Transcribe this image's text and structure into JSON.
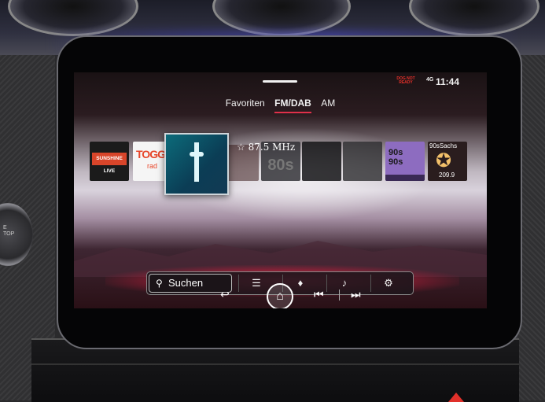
{
  "status": {
    "warning": "DOG NOT READY",
    "signal": "4G",
    "time": "11:44"
  },
  "tabs": [
    {
      "label": "Favoriten",
      "active": false
    },
    {
      "label": "FM/DAB",
      "active": true
    },
    {
      "label": "AM",
      "active": false
    }
  ],
  "stations": {
    "sunshine": "SUNSHINE LIVE",
    "toggo_logo": "TOGG",
    "toggo_sub": "rad",
    "tile5_text": "80s",
    "nineties_1": "90s",
    "nineties_2": "90s",
    "sachsen_name": "90sSachs",
    "sachsen_num": "209.9"
  },
  "now_playing": {
    "frequency": "87.5 MHz"
  },
  "toolbar": {
    "search_label": "Suchen"
  },
  "icons": {
    "search": "search-icon",
    "list": "list-icon",
    "sound": "equalizer-icon",
    "music": "music-note-icon",
    "settings": "gear-icon",
    "back": "back-arrow-icon",
    "home": "home-icon",
    "prev": "skip-previous-icon",
    "next": "skip-next-icon"
  },
  "colors": {
    "accent": "#e0304a",
    "glow": "#ff3a64"
  }
}
